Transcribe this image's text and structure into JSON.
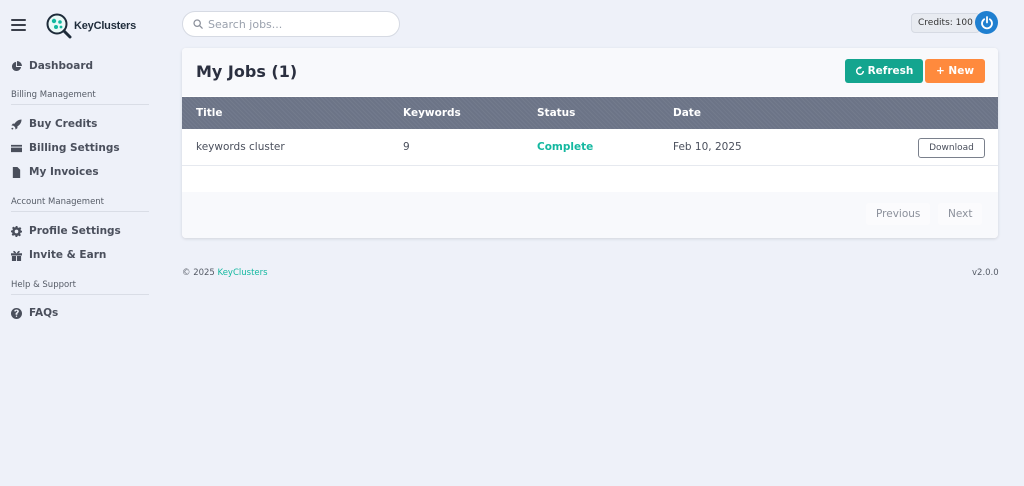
{
  "brand": {
    "name": "KeyClusters",
    "accent": "#14b8a0"
  },
  "sidebar": {
    "items": [
      {
        "label": "Dashboard",
        "icon": "pie-chart-icon"
      },
      {
        "label": "Buy Credits",
        "icon": "rocket-icon"
      },
      {
        "label": "Billing Settings",
        "icon": "credit-card-icon"
      },
      {
        "label": "My Invoices",
        "icon": "invoice-icon"
      },
      {
        "label": "Profile Settings",
        "icon": "gear-icon"
      },
      {
        "label": "Invite & Earn",
        "icon": "gift-icon"
      },
      {
        "label": "FAQs",
        "icon": "question-circle-icon"
      }
    ],
    "sections": [
      "Billing Management",
      "Account Management",
      "Help & Support"
    ]
  },
  "search": {
    "placeholder": "Search jobs...",
    "value": ""
  },
  "credits": {
    "label": "Credits: 100"
  },
  "jobs": {
    "title": "My Jobs (1)",
    "refresh_label": "Refresh",
    "new_label": "+ New",
    "columns": [
      "Title",
      "Keywords",
      "Status",
      "Date"
    ],
    "rows": [
      {
        "title": "keywords cluster",
        "keywords": "9",
        "status": "Complete",
        "date": "Feb 10, 2025",
        "action": "Download"
      }
    ],
    "pagination": {
      "prev": "Previous",
      "next": "Next"
    }
  },
  "footer": {
    "copyright": "© 2025 ",
    "brand": "KeyClusters",
    "version": "v2.0.0"
  },
  "colors": {
    "refresh": "#14a58f",
    "new": "#ff8a3d",
    "power": "#1f7fd0",
    "header": "#6c7487"
  }
}
